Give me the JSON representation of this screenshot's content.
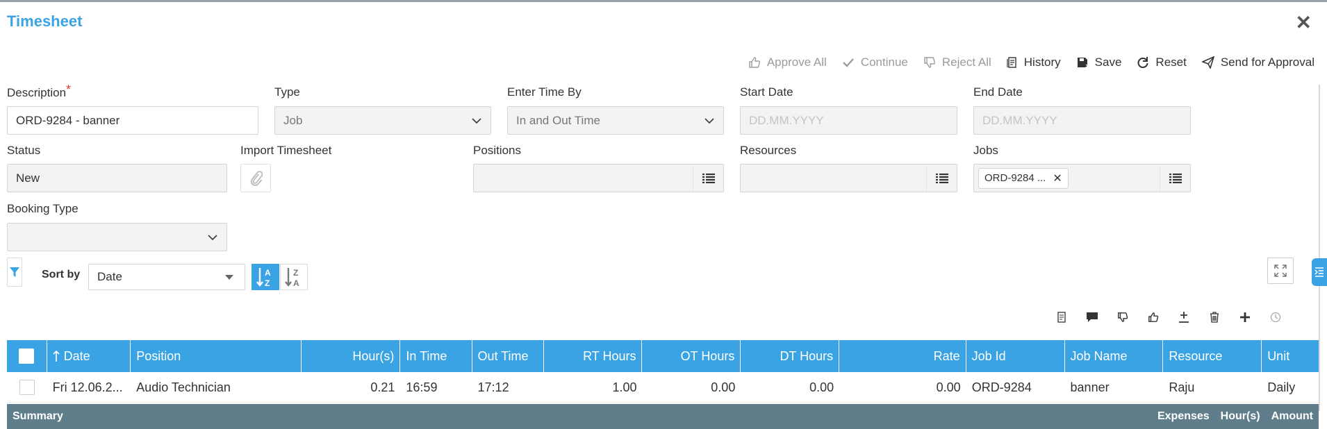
{
  "window": {
    "title": "Timesheet",
    "close_label": "✕"
  },
  "toolbar": {
    "approve_all": "Approve All",
    "continue": "Continue",
    "reject_all": "Reject All",
    "history": "History",
    "save": "Save",
    "reset": "Reset",
    "send_for_approval": "Send for Approval"
  },
  "form": {
    "description": {
      "label": "Description",
      "required_mark": "*",
      "value": "ORD-9284 - banner"
    },
    "type": {
      "label": "Type",
      "value": "Job"
    },
    "enter_time_by": {
      "label": "Enter Time By",
      "value": "In and Out Time"
    },
    "start_date": {
      "label": "Start Date",
      "placeholder": "DD.MM.YYYY"
    },
    "end_date": {
      "label": "End Date",
      "placeholder": "DD.MM.YYYY"
    },
    "status": {
      "label": "Status",
      "value": "New"
    },
    "import_timesheet": {
      "label": "Import Timesheet"
    },
    "positions": {
      "label": "Positions"
    },
    "resources": {
      "label": "Resources"
    },
    "jobs": {
      "label": "Jobs",
      "chip": "ORD-9284 ...",
      "chip_remove": "✕"
    },
    "booking_type": {
      "label": "Booking Type",
      "value": ""
    }
  },
  "sort": {
    "label": "Sort by",
    "value": "Date"
  },
  "grid": {
    "headers": [
      "Date",
      "Position",
      "Hour(s)",
      "In Time",
      "Out Time",
      "RT Hours",
      "OT Hours",
      "DT Hours",
      "Rate",
      "Job Id",
      "Job Name",
      "Resource",
      "Unit"
    ],
    "rows": [
      [
        "Fri 12.06.2...",
        "Audio Technician",
        "0.21",
        "16:59",
        "17:12",
        "1.00",
        "0.00",
        "0.00",
        "0.00",
        "ORD-9284",
        "banner",
        "Raju",
        "Daily"
      ]
    ]
  },
  "summary": {
    "label": "Summary",
    "expenses": "Expenses",
    "hours": "Hour(s)",
    "amount": "Amount"
  },
  "colors": {
    "accent": "#3aa3e3",
    "summary_bg": "#607d8b",
    "required": "#e53935"
  }
}
